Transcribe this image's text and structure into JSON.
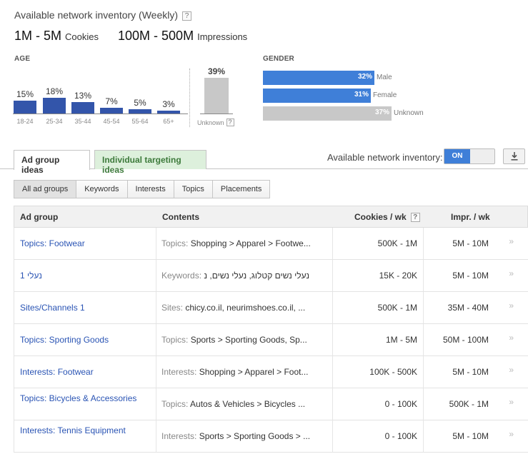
{
  "header": {
    "title": "Available network inventory (Weekly)",
    "help": "?",
    "cookies_value": "1M - 5M",
    "cookies_unit": "Cookies",
    "impressions_value": "100M - 500M",
    "impressions_unit": "Impressions"
  },
  "age": {
    "label": "AGE",
    "groups": [
      {
        "label": "18-24",
        "percent": "15%",
        "value": 15
      },
      {
        "label": "25-34",
        "percent": "18%",
        "value": 18
      },
      {
        "label": "35-44",
        "percent": "13%",
        "value": 13
      },
      {
        "label": "45-54",
        "percent": "7%",
        "value": 7
      },
      {
        "label": "55-64",
        "percent": "5%",
        "value": 5
      },
      {
        "label": "65+",
        "percent": "3%",
        "value": 3
      }
    ],
    "unknown": {
      "label": "Unknown",
      "percent": "39%",
      "value": 39,
      "help": "?"
    }
  },
  "gender": {
    "label": "GENDER",
    "items": [
      {
        "label": "Male",
        "percent": "32%",
        "value": 32,
        "color": "#3f7fd8"
      },
      {
        "label": "Female",
        "percent": "31%",
        "value": 31,
        "color": "#3f7fd8"
      },
      {
        "label": "Unknown",
        "percent": "37%",
        "value": 37,
        "color": "#c8c8c8"
      }
    ]
  },
  "tabs": {
    "ad_group_ideas": "Ad group ideas",
    "individual_targeting_ideas": "Individual targeting ideas"
  },
  "inventory_toggle": {
    "label": "Available network inventory:",
    "state": "ON"
  },
  "download_icon": "download-icon",
  "filters": [
    "All ad groups",
    "Keywords",
    "Interests",
    "Topics",
    "Placements"
  ],
  "table": {
    "columns": {
      "ad_group": "Ad group",
      "contents": "Contents",
      "cookies": "Cookies / wk",
      "cookies_help": "?",
      "impr": "Impr. / wk"
    },
    "rows": [
      {
        "ad_group": "Topics: Footwear",
        "content_type": "Topics:",
        "content_value": "Shopping > Apparel > Footwe...",
        "cookies": "500K - 1M",
        "impr": "5M - 10M",
        "arrow": "»"
      },
      {
        "ad_group": "נעלי 1",
        "content_type": "Keywords:",
        "content_value": "נעלי נשים קטלוג, נעלי נשים, נ",
        "cookies": "15K - 20K",
        "impr": "5M - 10M",
        "arrow": "»"
      },
      {
        "ad_group": "Sites/Channels 1",
        "content_type": "Sites:",
        "content_value": "chicy.co.il, neurimshoes.co.il, ...",
        "cookies": "500K - 1M",
        "impr": "35M - 40M",
        "arrow": "»"
      },
      {
        "ad_group": "Topics: Sporting Goods",
        "content_type": "Topics:",
        "content_value": "Sports > Sporting Goods, Sp...",
        "cookies": "1M - 5M",
        "impr": "50M - 100M",
        "arrow": "»"
      },
      {
        "ad_group": "Interests: Footwear",
        "content_type": "Interests:",
        "content_value": "Shopping > Apparel > Foot...",
        "cookies": "100K - 500K",
        "impr": "5M - 10M",
        "arrow": "»"
      },
      {
        "ad_group": "Topics: Bicycles & Accessories",
        "content_type": "Topics:",
        "content_value": "Autos & Vehicles > Bicycles ...",
        "cookies": "0 - 100K",
        "impr": "500K - 1M",
        "arrow": "»"
      },
      {
        "ad_group": "Interests: Tennis Equipment",
        "content_type": "Interests:",
        "content_value": "Sports > Sporting Goods > ...",
        "cookies": "0 - 100K",
        "impr": "5M - 10M",
        "arrow": "»"
      }
    ]
  }
}
